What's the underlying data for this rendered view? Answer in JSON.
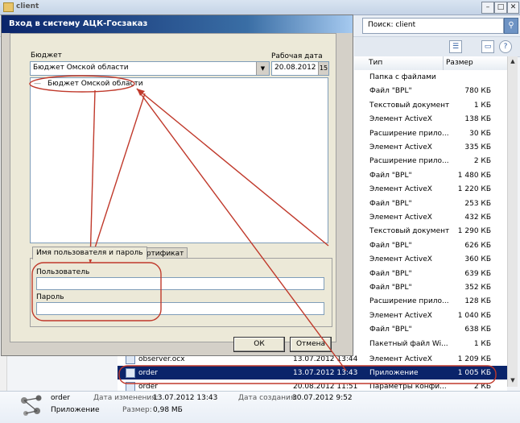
{
  "explorer": {
    "title": "client",
    "search_placeholder": "Поиск: client",
    "columns": {
      "type": "Тип",
      "size": "Размер"
    },
    "rows": [
      {
        "type": "Папка с файлами",
        "size": ""
      },
      {
        "type": "Файл \"BPL\"",
        "size": "780 КБ"
      },
      {
        "type": "Текстовый документ",
        "size": "1 КБ"
      },
      {
        "type": "Элемент ActiveX",
        "size": "138 КБ"
      },
      {
        "type": "Расширение прило...",
        "size": "30 КБ"
      },
      {
        "type": "Элемент ActiveX",
        "size": "335 КБ"
      },
      {
        "type": "Расширение прило...",
        "size": "2 КБ"
      },
      {
        "type": "Файл \"BPL\"",
        "size": "1 480 КБ"
      },
      {
        "type": "Элемент ActiveX",
        "size": "1 220 КБ"
      },
      {
        "type": "Файл \"BPL\"",
        "size": "253 КБ"
      },
      {
        "type": "Элемент ActiveX",
        "size": "432 КБ"
      },
      {
        "type": "Текстовый документ",
        "size": "1 290 КБ"
      },
      {
        "type": "Файл \"BPL\"",
        "size": "626 КБ"
      },
      {
        "type": "Элемент ActiveX",
        "size": "360 КБ"
      },
      {
        "type": "Файл \"BPL\"",
        "size": "639 КБ"
      },
      {
        "type": "Файл \"BPL\"",
        "size": "352 КБ"
      },
      {
        "type": "Расширение прило...",
        "size": "128 КБ"
      },
      {
        "type": "Элемент ActiveX",
        "size": "1 040 КБ"
      },
      {
        "type": "Файл \"BPL\"",
        "size": "638 КБ"
      },
      {
        "type": "Пакетный файл Wi...",
        "size": "1 КБ"
      }
    ],
    "lower_rows": [
      {
        "name": "observer.ocx",
        "date": "13.07.2012 13:44",
        "type": "Элемент ActiveX",
        "size": "1 209 КБ"
      },
      {
        "name": "order",
        "date": "13.07.2012 13:43",
        "type": "Приложение",
        "size": "1 005 КБ"
      },
      {
        "name": "order",
        "date": "20.08.2012 11:51",
        "type": "Параметры конфи...",
        "size": "2 КБ"
      }
    ],
    "details": {
      "name": "order",
      "kind": "Приложение",
      "modified_label": "Дата изменения:",
      "modified": "13.07.2012 13:43",
      "created_label": "Дата создания:",
      "created": "30.07.2012 9:52",
      "size_label": "Размер:",
      "size": "0,98 МБ"
    }
  },
  "dialog": {
    "title": "Вход в систему АЦК-Госзаказ",
    "budget_label": "Бюджет",
    "budget_value": "Бюджет Омской области",
    "date_label": "Рабочая дата",
    "date_value": "20.08.2012",
    "tree_item": "Бюджет Омской области",
    "tabs": [
      "Имя пользователя и пароль",
      "Сертификат"
    ],
    "user_label": "Пользователь",
    "user_value": "",
    "password_label": "Пароль",
    "password_value": "",
    "ok_label": "ОК",
    "cancel_label": "Отмена"
  },
  "colors": {
    "selection": "#0a246a",
    "annotation": "#c0392b",
    "dialog_title": "#0a246a"
  }
}
